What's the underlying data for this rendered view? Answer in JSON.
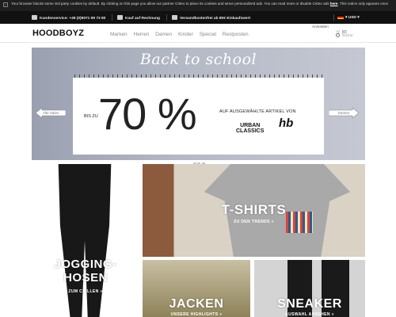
{
  "cookie_bar": {
    "text": "Your browser blocks some 3rd party cookies by default. By clicking on this page you allow our partner Criteo to place its cookies and serve personalized ads. You can read more or disable Criteo ads",
    "link": "here",
    "text_end": ". This notice only appears once"
  },
  "service_bar": {
    "hotline": "Kundenservice: +49 (0)9071 99 73 80",
    "invoice": "Kauf auf Rechnung",
    "shipping": "Versandkostenfrei ab 80€ Einkaufswert",
    "currency": "USD ▾"
  },
  "header": {
    "logo": "HOODBOYZ",
    "nav": [
      "Marken",
      "Herren",
      "Damen",
      "Kinder",
      "Special",
      "Restposten"
    ],
    "login": "Anmelden",
    "cart": "(0)",
    "search_placeholder": "Suche"
  },
  "hero": {
    "title": "Back to school",
    "bis_zu": "BIS ZU",
    "percent": "70 %",
    "promo": "AUF AUSGEWÄHLTE ARTIKEL VON",
    "brand_1": "URBAN CLASSICS",
    "brand_2": "hb",
    "prev_label": "Alte Sales",
    "next_label": "Damen",
    "slide_count": 4,
    "active_slide": 1
  },
  "tiles": [
    {
      "title": "JOGGING-HOSEN",
      "line1": "JOGGING-",
      "line2": "HOSEN",
      "subtitle": "ZUM CHILLEN »"
    },
    {
      "title": "T-SHIRTS",
      "subtitle": "ZU DEN TRENDS »"
    },
    {
      "title": "JACKEN",
      "subtitle": "UNSERE HIGHLIGHTS »"
    },
    {
      "title": "SNEAKER",
      "subtitle": "AUSWAHL ANSEHEN »"
    }
  ],
  "colors": {
    "topbar": "#111111",
    "accent_white": "#ffffff",
    "nav_text": "#8a8a8a"
  }
}
